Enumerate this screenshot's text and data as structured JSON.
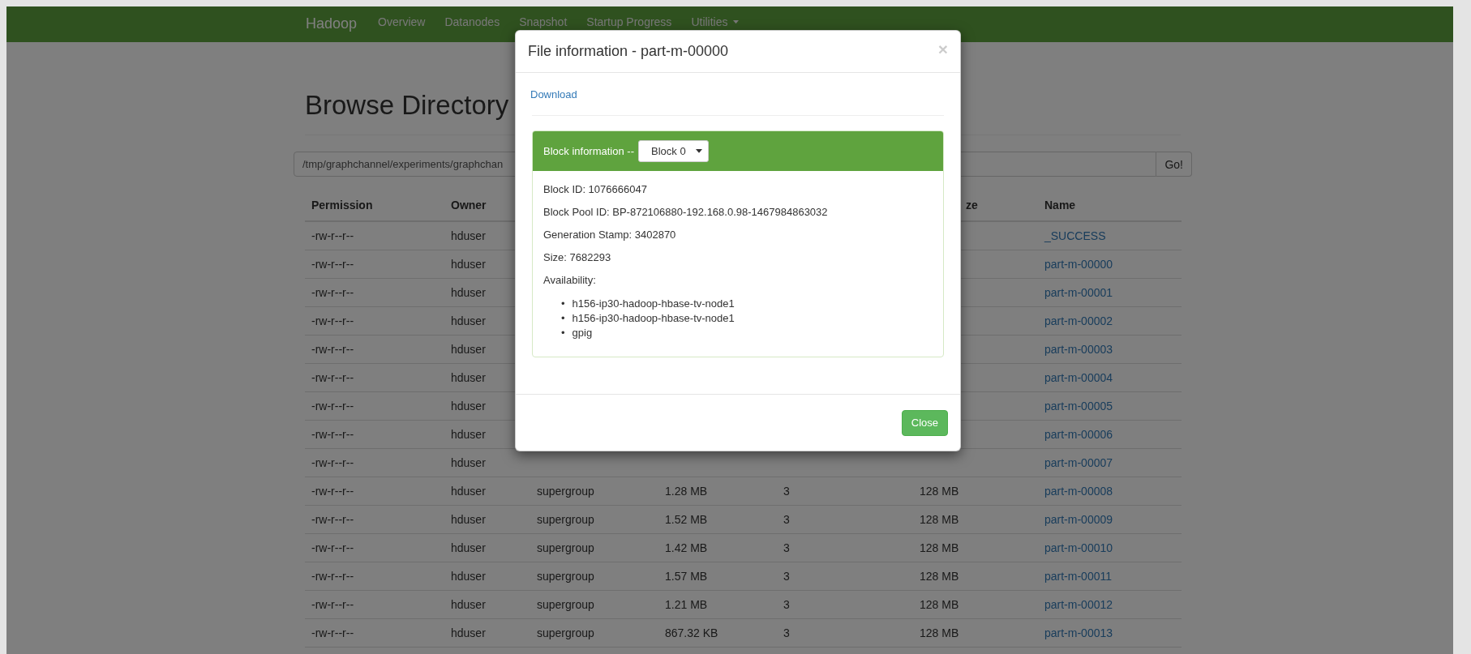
{
  "navbar": {
    "brand": "Hadoop",
    "items": [
      {
        "label": "Overview",
        "dropdown": false
      },
      {
        "label": "Datanodes",
        "dropdown": false
      },
      {
        "label": "Snapshot",
        "dropdown": false
      },
      {
        "label": "Startup Progress",
        "dropdown": false
      },
      {
        "label": "Utilities",
        "dropdown": true
      }
    ]
  },
  "page": {
    "heading": "Browse Directory",
    "path": {
      "value": "/tmp/graphchannel/experiments/graphchan"
    },
    "go_button": "Go!"
  },
  "table": {
    "columns": [
      "Permission",
      "Owner",
      null,
      null,
      null,
      "ze",
      "Name"
    ],
    "rows": [
      {
        "cells": [
          "-rw-r--r--",
          "hduser",
          null,
          null,
          null,
          null,
          "_SUCCESS"
        ]
      },
      {
        "cells": [
          "-rw-r--r--",
          "hduser",
          null,
          null,
          null,
          null,
          "part-m-00000"
        ]
      },
      {
        "cells": [
          "-rw-r--r--",
          "hduser",
          null,
          null,
          null,
          null,
          "part-m-00001"
        ]
      },
      {
        "cells": [
          "-rw-r--r--",
          "hduser",
          null,
          null,
          null,
          null,
          "part-m-00002"
        ]
      },
      {
        "cells": [
          "-rw-r--r--",
          "hduser",
          null,
          null,
          null,
          null,
          "part-m-00003"
        ]
      },
      {
        "cells": [
          "-rw-r--r--",
          "hduser",
          null,
          null,
          null,
          null,
          "part-m-00004"
        ]
      },
      {
        "cells": [
          "-rw-r--r--",
          "hduser",
          null,
          null,
          null,
          null,
          "part-m-00005"
        ]
      },
      {
        "cells": [
          "-rw-r--r--",
          "hduser",
          null,
          null,
          null,
          null,
          "part-m-00006"
        ]
      },
      {
        "cells": [
          "-rw-r--r--",
          "hduser",
          null,
          null,
          null,
          null,
          "part-m-00007"
        ]
      },
      {
        "cells": [
          "-rw-r--r--",
          "hduser",
          "supergroup",
          "1.28 MB",
          "3",
          "128 MB",
          "part-m-00008"
        ]
      },
      {
        "cells": [
          "-rw-r--r--",
          "hduser",
          "supergroup",
          "1.52 MB",
          "3",
          "128 MB",
          "part-m-00009"
        ]
      },
      {
        "cells": [
          "-rw-r--r--",
          "hduser",
          "supergroup",
          "1.42 MB",
          "3",
          "128 MB",
          "part-m-00010"
        ]
      },
      {
        "cells": [
          "-rw-r--r--",
          "hduser",
          "supergroup",
          "1.57 MB",
          "3",
          "128 MB",
          "part-m-00011"
        ]
      },
      {
        "cells": [
          "-rw-r--r--",
          "hduser",
          "supergroup",
          "1.21 MB",
          "3",
          "128 MB",
          "part-m-00012"
        ]
      },
      {
        "cells": [
          "-rw-r--r--",
          "hduser",
          "supergroup",
          "867.32 KB",
          "3",
          "128 MB",
          "part-m-00013"
        ]
      }
    ]
  },
  "modal": {
    "title": "File information - part-m-00000",
    "close_icon": "×",
    "download_link": "Download",
    "block_panel": {
      "label": "Block information --",
      "select": {
        "value": "Block 0"
      },
      "fields": [
        "Block ID: 1076666047",
        "Block Pool ID: BP-872106880-192.168.0.98-1467984863032",
        "Generation Stamp: 3402870",
        "Size: 7682293",
        "Availability:"
      ],
      "bullet": "•",
      "hosts": [
        "h156-ip30-hadoop-hbase-tv-node1",
        "h156-ip30-hadoop-hbase-tv-node1",
        "gpig"
      ]
    },
    "close_button": "Close"
  }
}
